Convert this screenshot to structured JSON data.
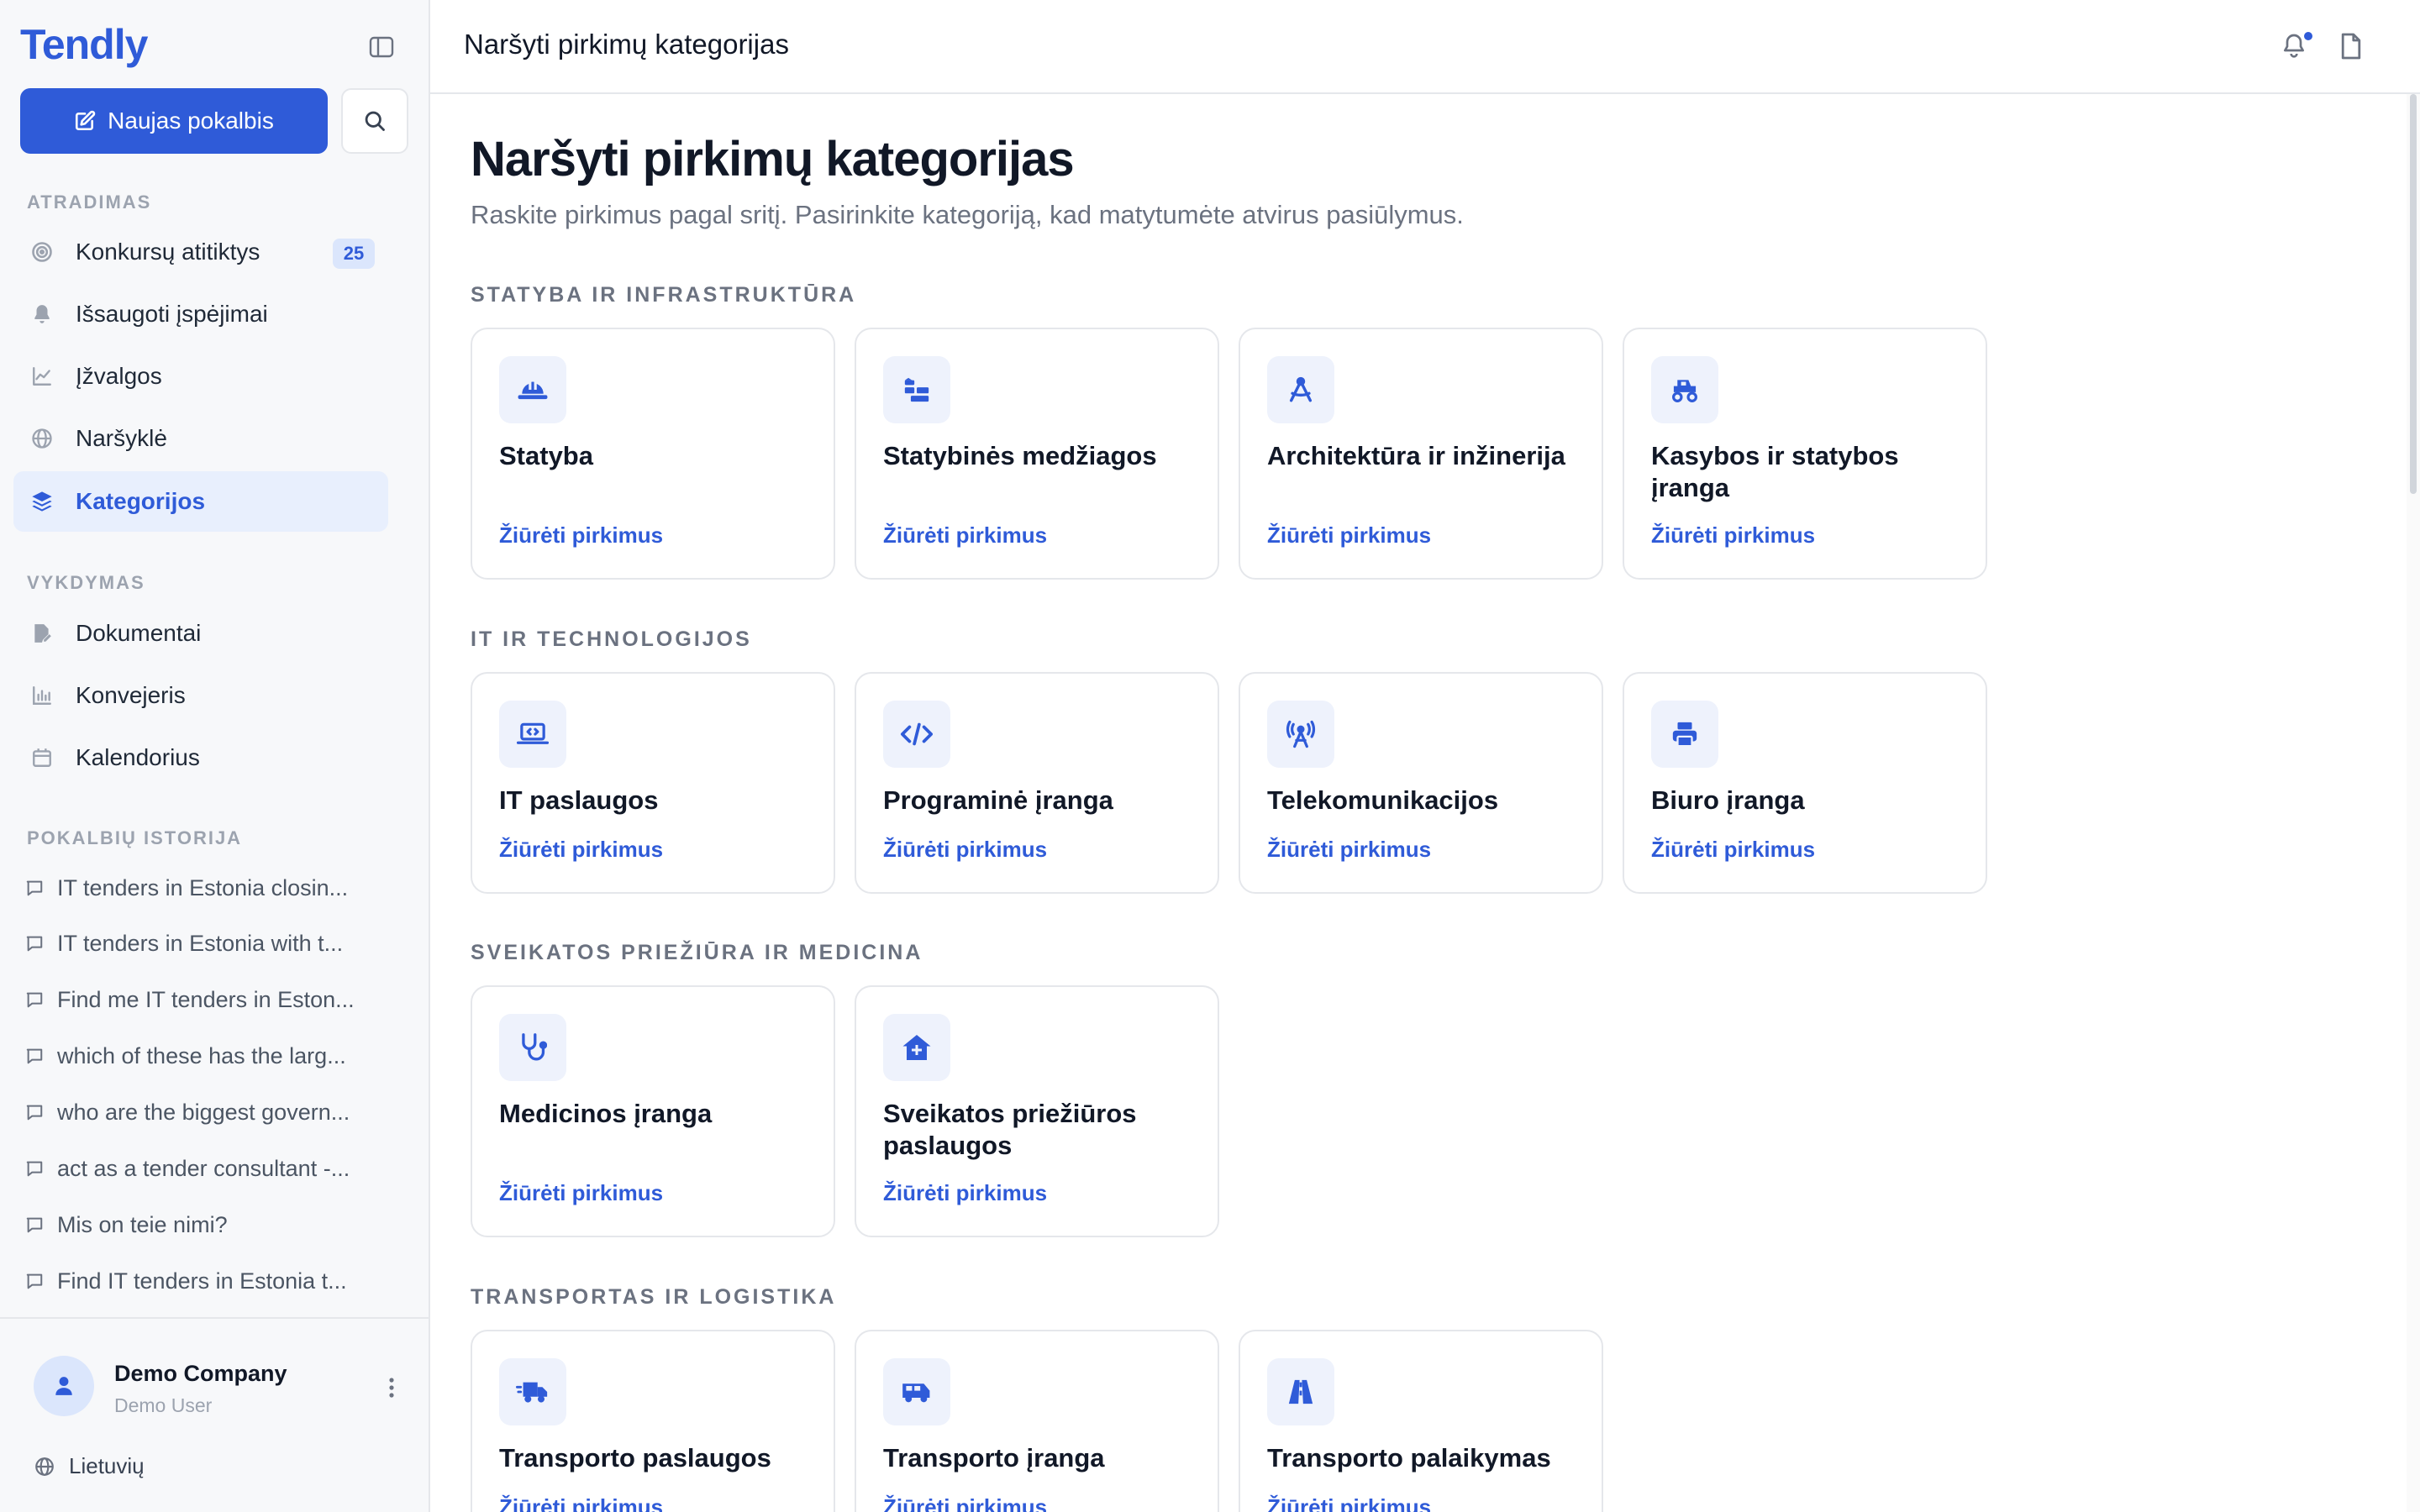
{
  "app": {
    "brand": "Tendly",
    "new_chat_label": "Naujas pokalbis"
  },
  "sidebar": {
    "discovery_label": "ATRADIMAS",
    "discovery_items": [
      {
        "label": "Konkursų atitiktys",
        "icon": "target-icon",
        "badge": "25"
      },
      {
        "label": "Išsaugoti įspėjimai",
        "icon": "bell-icon"
      },
      {
        "label": "Įžvalgos",
        "icon": "line-chart-icon"
      },
      {
        "label": "Naršyklė",
        "icon": "globe-icon"
      },
      {
        "label": "Kategorijos",
        "icon": "layers-icon",
        "active": true
      }
    ],
    "execution_label": "VYKDYMAS",
    "execution_items": [
      {
        "label": "Dokumentai",
        "icon": "file-edit-icon"
      },
      {
        "label": "Konvejeris",
        "icon": "bar-chart-icon"
      },
      {
        "label": "Kalendorius",
        "icon": "calendar-icon"
      }
    ],
    "history_label": "POKALBIŲ ISTORIJA",
    "history": [
      "IT tenders in Estonia closin...",
      "IT tenders in Estonia with t...",
      "Find me IT tenders in Eston...",
      "which of these has the larg...",
      "who are the biggest govern...",
      "act as a tender consultant -...",
      "Mis on teie nimi?",
      "Find IT tenders in Estonia t..."
    ],
    "user": {
      "company": "Demo Company",
      "role": "Demo User",
      "language": "Lietuvių"
    }
  },
  "header": {
    "title": "Naršyti pirkimų kategorijas"
  },
  "main": {
    "title": "Naršyti pirkimų kategorijas",
    "subtitle": "Raskite pirkimus pagal sritį. Pasirinkite kategoriją, kad matytumėte atvirus pasiūlymus.",
    "link_label": "Žiūrėti pirkimus",
    "groups": [
      {
        "heading": "STATYBA IR INFRASTRUKTŪRA",
        "cards": [
          {
            "title": "Statyba",
            "icon": "hard-hat-icon"
          },
          {
            "title": "Statybinės medžiagos",
            "icon": "bricks-icon"
          },
          {
            "title": "Architektūra ir inžinerija",
            "icon": "compass-drafting-icon"
          },
          {
            "title": "Kasybos ir statybos įranga",
            "icon": "excavator-icon"
          }
        ]
      },
      {
        "heading": "IT IR TECHNOLOGIJOS",
        "cards": [
          {
            "title": "IT paslaugos",
            "icon": "laptop-code-icon"
          },
          {
            "title": "Programinė įranga",
            "icon": "code-icon"
          },
          {
            "title": "Telekomunikacijos",
            "icon": "tower-broadcast-icon"
          },
          {
            "title": "Biuro įranga",
            "icon": "printer-icon"
          }
        ]
      },
      {
        "heading": "SVEIKATOS PRIEŽIŪRA IR MEDICINA",
        "cards": [
          {
            "title": "Medicinos įranga",
            "icon": "stethoscope-icon"
          },
          {
            "title": "Sveikatos priežiūros paslaugos",
            "icon": "house-medical-icon"
          }
        ]
      },
      {
        "heading": "TRANSPORTAS IR LOGISTIKA",
        "cards": [
          {
            "title": "Transporto paslaugos",
            "icon": "truck-fast-icon"
          },
          {
            "title": "Transporto įranga",
            "icon": "van-icon"
          },
          {
            "title": "Transporto palaikymas",
            "icon": "road-icon"
          }
        ]
      }
    ]
  },
  "colors": {
    "accent": "#2f5bd8",
    "sidebar_bg": "#f7f8fa",
    "active_bg": "#e8effd",
    "icon_box_bg": "#eef2fc"
  }
}
